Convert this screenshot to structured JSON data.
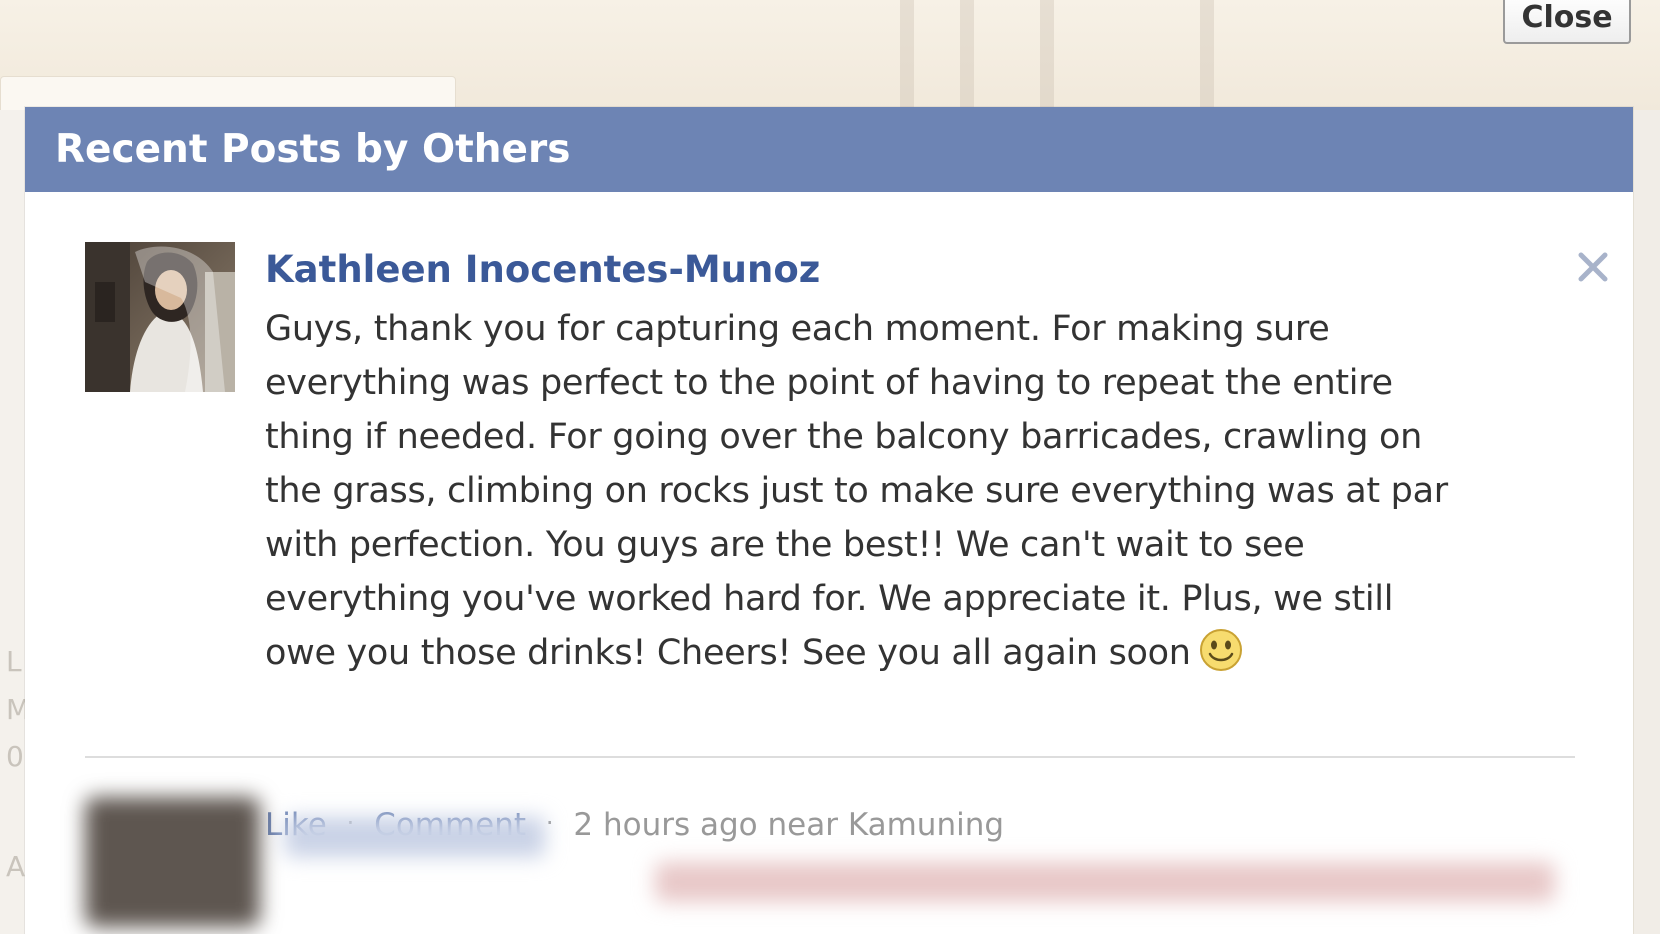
{
  "dialog": {
    "title": "Recent Posts by Others",
    "close_label": "Close"
  },
  "post": {
    "author": "Kathleen Inocentes-Munoz",
    "message": "Guys, thank you for capturing each moment. For making sure\neverything was perfect to the point of having to repeat the entire\nthing if needed. For going over the balcony barricades, crawling on\nthe grass, climbing on rocks just to make sure everything was at par\nwith perfection. You guys are the best!! We can't wait to see\neverything you've worked hard for. We appreciate it. Plus, we still\nowe you those drinks! Cheers! See you all again soon",
    "actions": {
      "like": "Like",
      "comment": "Comment",
      "meta": "2 hours ago near Kamuning"
    },
    "emoji_icon": "smiley-icon"
  },
  "background_sidebar_letters": [
    "L",
    "M",
    "0",
    "A"
  ],
  "colors": {
    "header_bg": "#6d84b4",
    "author_link": "#3b5998",
    "action_link": "#6d84b4",
    "meta_text": "#999999"
  }
}
